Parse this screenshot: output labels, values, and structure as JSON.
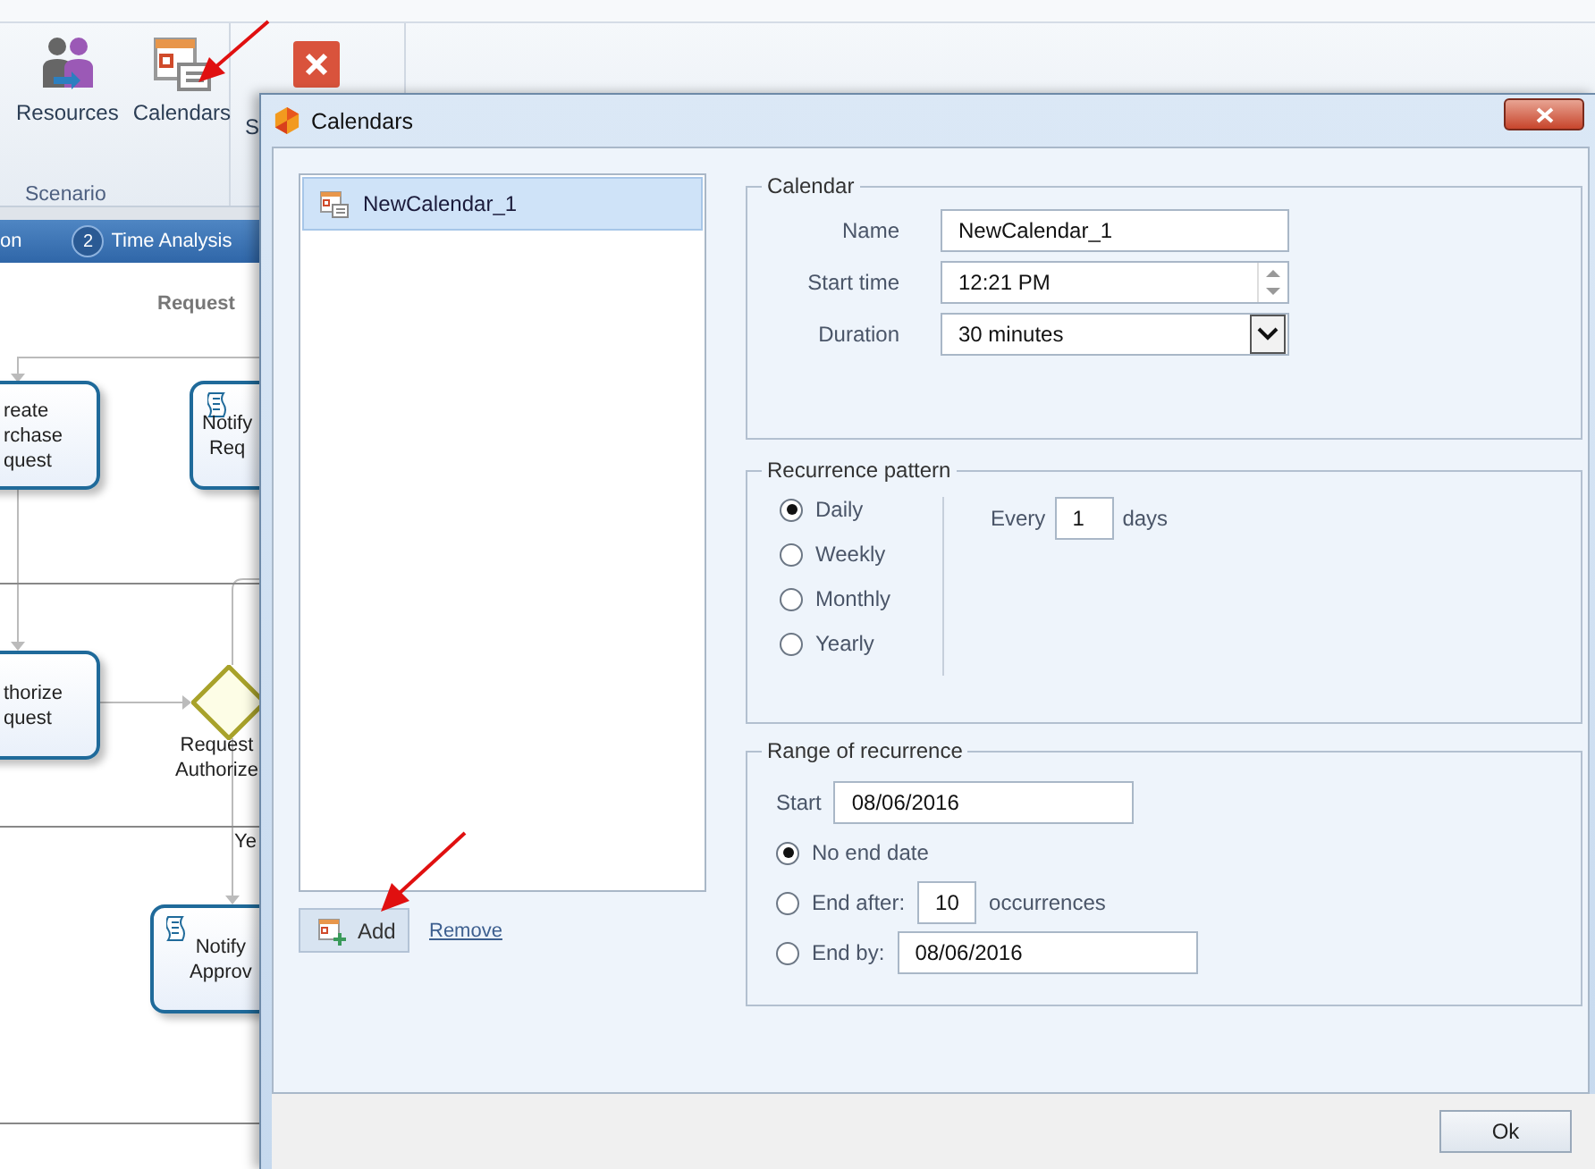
{
  "ribbon": {
    "buttons": [
      {
        "kind": "resources",
        "label": "Resources"
      },
      {
        "kind": "calendars",
        "label": "Calendars"
      },
      {
        "kind": "close",
        "label": "S"
      }
    ],
    "group_label": "Scenario"
  },
  "breadcrumb": [
    {
      "label": "on"
    },
    {
      "number": "2",
      "label": "Time Analysis"
    }
  ],
  "diagram": {
    "lane_label": "Request",
    "nodes": [
      {
        "kind": "task",
        "lines": [
          "reate",
          "rchase",
          "quest"
        ]
      },
      {
        "kind": "script",
        "lines": [
          "Notify",
          "Req"
        ]
      },
      {
        "kind": "task",
        "lines": [
          "thorize",
          "quest"
        ]
      },
      {
        "kind": "gateway",
        "lines": [
          "Request",
          "Authorize"
        ]
      },
      {
        "kind": "script",
        "lines": [
          "Notify",
          "Approv"
        ]
      }
    ],
    "edge_label": "Ye"
  },
  "dialog": {
    "title": "Calendars",
    "calendars": [
      {
        "name": "NewCalendar_1",
        "selected": true
      }
    ],
    "add_button": "Add",
    "remove_link": "Remove",
    "calendar_group": {
      "title": "Calendar",
      "fields": [
        {
          "kind": "text",
          "label": "Name",
          "value": "NewCalendar_1"
        },
        {
          "kind": "spinner",
          "label": "Start time",
          "value": "12:21 PM"
        },
        {
          "kind": "dropdown",
          "label": "Duration",
          "value": "30 minutes"
        }
      ]
    },
    "recurrence_pattern": {
      "title": "Recurrence pattern",
      "options": [
        {
          "label": "Daily",
          "selected": true
        },
        {
          "label": "Weekly",
          "selected": false
        },
        {
          "label": "Monthly",
          "selected": false
        },
        {
          "label": "Yearly",
          "selected": false
        }
      ],
      "every_label": "Every",
      "every_value": "1",
      "unit": "days"
    },
    "range": {
      "title": "Range of recurrence",
      "start_label": "Start",
      "start_value": "08/06/2016",
      "options": [
        {
          "kind": "none",
          "label": "No end date",
          "selected": true
        },
        {
          "kind": "after",
          "label": "End after:",
          "value": "10",
          "suffix": "occurrences",
          "selected": false
        },
        {
          "kind": "by",
          "label": "End by:",
          "value": "08/06/2016",
          "selected": false
        }
      ]
    },
    "ok_button": "Ok"
  }
}
